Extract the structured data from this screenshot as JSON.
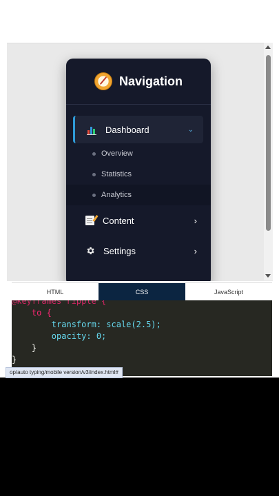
{
  "sidebar": {
    "title": "Navigation",
    "items": [
      {
        "label": "Dashboard",
        "icon": "bar-chart-icon",
        "expanded": true,
        "children": [
          {
            "label": "Overview"
          },
          {
            "label": "Statistics"
          },
          {
            "label": "Analytics"
          }
        ]
      },
      {
        "label": "Content",
        "icon": "memo-icon"
      },
      {
        "label": "Settings",
        "icon": "gear-icon"
      }
    ],
    "chevron_right": "›",
    "chevron_down": "⌄"
  },
  "tabs": [
    "HTML",
    "CSS",
    "JavaScript"
  ],
  "active_tab": "CSS",
  "code_lines": [
    "@keyframes ripple {",
    "    to {",
    "        transform: scale(2.5);",
    "        opacity: 0;",
    "    }",
    "}"
  ],
  "status_url": "op/auto typing/mobile version/v3/index.html#",
  "colors": {
    "sidebar_bg": "#15192a",
    "accent": "#2f9bd8",
    "code_bg": "#272822",
    "active_tab_bg": "#0b2541"
  }
}
